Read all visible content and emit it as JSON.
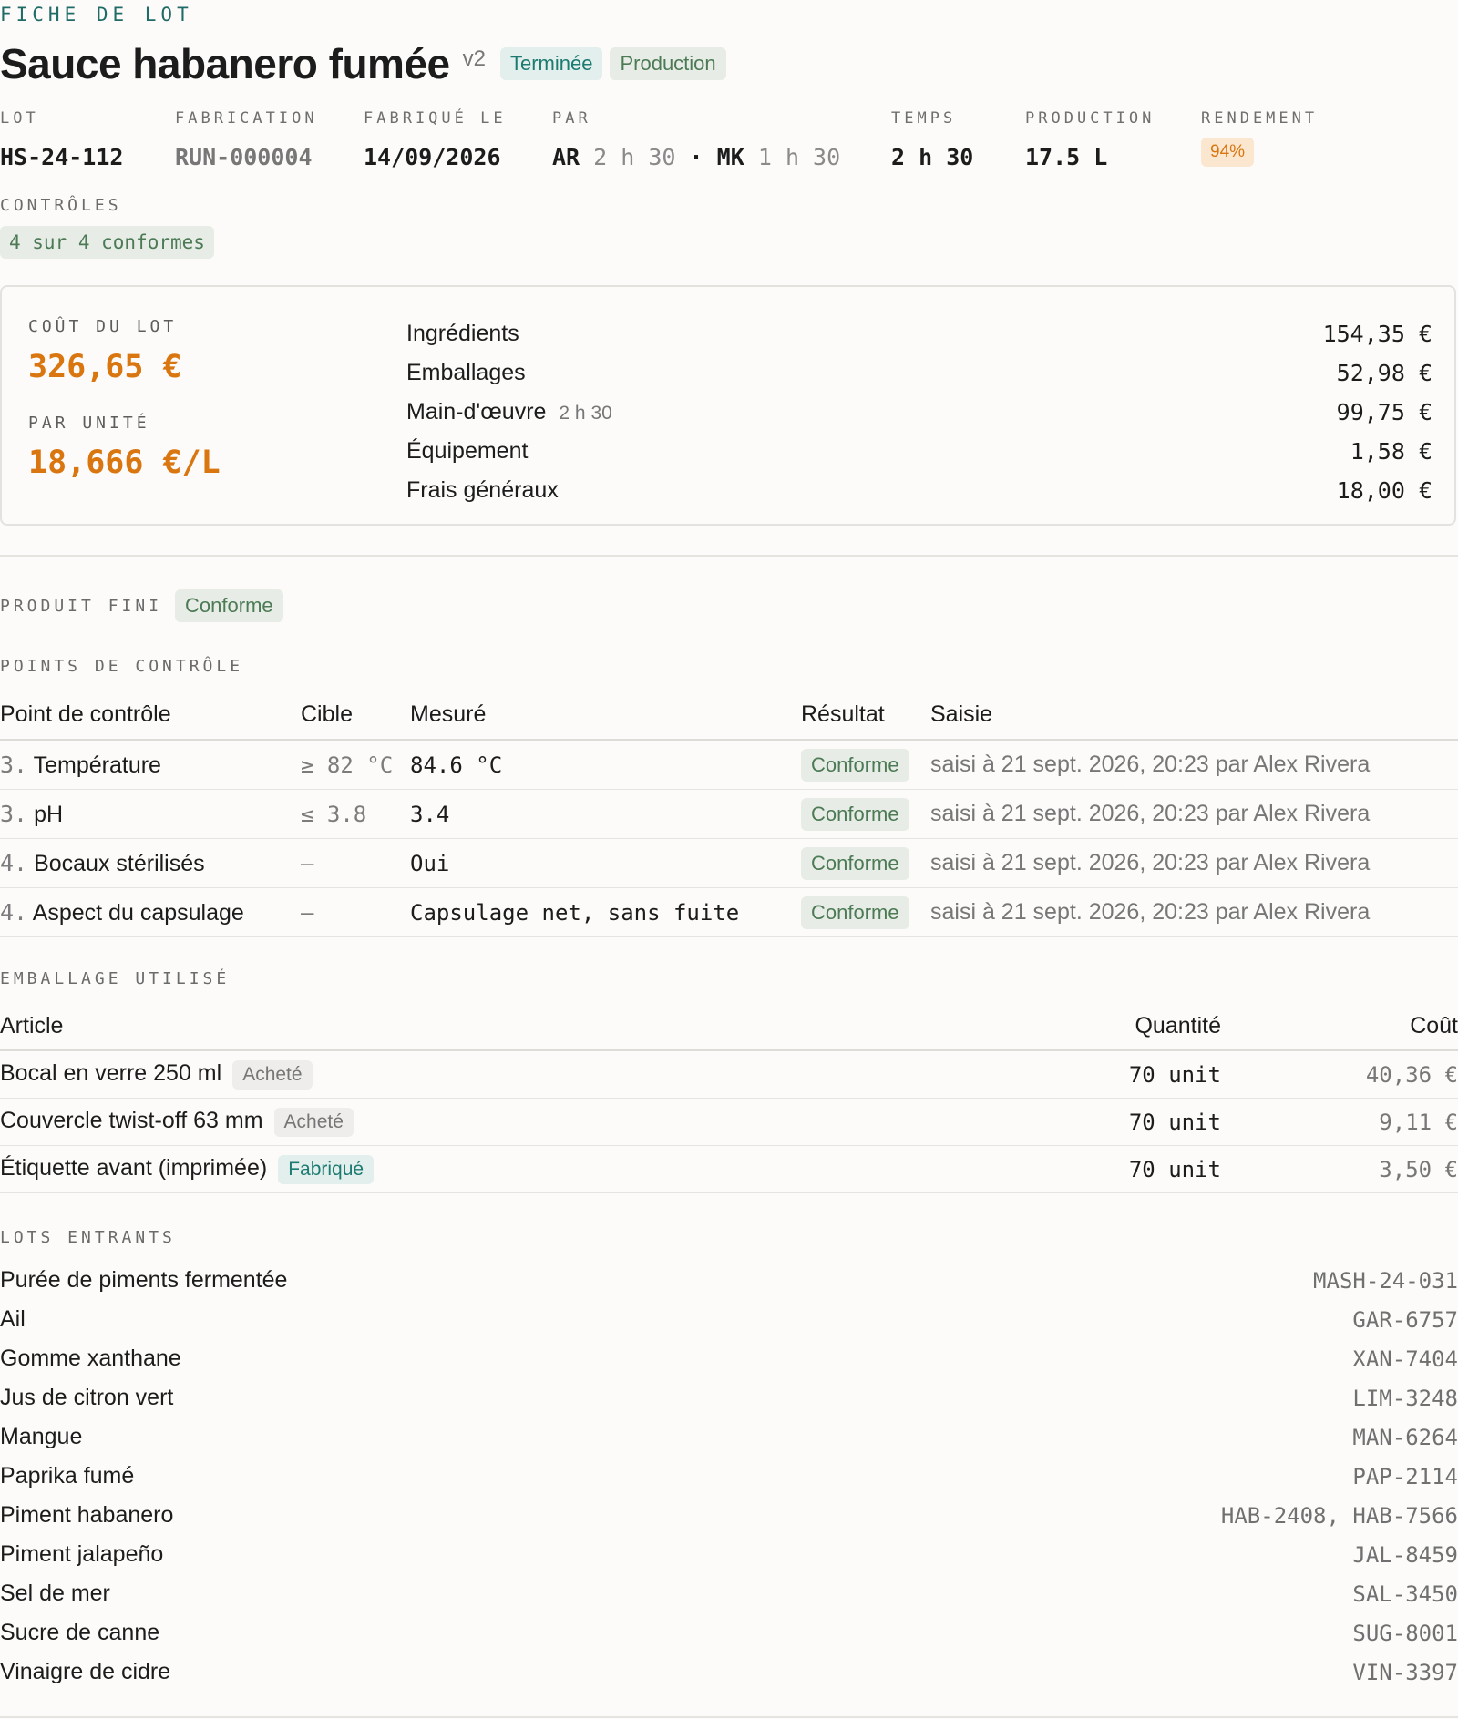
{
  "header": {
    "kicker": "FICHE DE LOT",
    "title": "Sauce habanero fumée",
    "version": "v2",
    "status_tag": "Terminée",
    "type_tag": "Production"
  },
  "meta": {
    "lot": {
      "label": "LOT",
      "value": "HS-24-112"
    },
    "fabrication": {
      "label": "FABRICATION",
      "value": "RUN-000004"
    },
    "fabrique_le": {
      "label": "FABRIQUÉ LE",
      "value": "14/09/2026"
    },
    "par": {
      "label": "PAR",
      "op1": "AR",
      "op1_time": "2 h 30",
      "sep": "·",
      "op2": "MK",
      "op2_time": "1 h 30"
    },
    "temps": {
      "label": "TEMPS",
      "value": "2 h 30"
    },
    "production": {
      "label": "PRODUCTION",
      "value": "17.5 L"
    },
    "rendement": {
      "label": "RENDEMENT",
      "value": "94%"
    }
  },
  "controles": {
    "label": "CONTRÔLES",
    "summary": "4 sur 4 conformes"
  },
  "cost": {
    "lot_label": "COÛT DU LOT",
    "lot_value": "326,65 €",
    "unit_label": "PAR UNITÉ",
    "unit_value": "18,666 €/L",
    "lines": [
      {
        "label": "Ingrédients",
        "sub": "",
        "amount": "154,35 €"
      },
      {
        "label": "Emballages",
        "sub": "",
        "amount": "52,98 €"
      },
      {
        "label": "Main-d'œuvre",
        "sub": "2 h 30",
        "amount": "99,75 €"
      },
      {
        "label": "Équipement",
        "sub": "",
        "amount": "1,58 €"
      },
      {
        "label": "Frais généraux",
        "sub": "",
        "amount": "18,00 €"
      }
    ]
  },
  "produit_fini": {
    "label": "PRODUIT FINI",
    "status": "Conforme"
  },
  "points": {
    "label": "POINTS DE CONTRÔLE",
    "headers": [
      "Point de contrôle",
      "Cible",
      "Mesuré",
      "Résultat",
      "Saisie"
    ],
    "rows": [
      {
        "num": "3.",
        "name": "Température",
        "target": "≥ 82 °C",
        "measured": "84.6 °C",
        "result": "Conforme",
        "entry": "saisi à 21 sept. 2026, 20:23 par Alex Rivera"
      },
      {
        "num": "3.",
        "name": "pH",
        "target": "≤ 3.8",
        "measured": "3.4",
        "result": "Conforme",
        "entry": "saisi à 21 sept. 2026, 20:23 par Alex Rivera"
      },
      {
        "num": "4.",
        "name": "Bocaux stérilisés",
        "target": "—",
        "measured": "Oui",
        "result": "Conforme",
        "entry": "saisi à 21 sept. 2026, 20:23 par Alex Rivera"
      },
      {
        "num": "4.",
        "name": "Aspect du capsulage",
        "target": "—",
        "measured": "Capsulage net, sans fuite",
        "result": "Conforme",
        "entry": "saisi à 21 sept. 2026, 20:23 par Alex Rivera"
      }
    ]
  },
  "emballage": {
    "label": "EMBALLAGE UTILISÉ",
    "headers": [
      "Article",
      "Quantité",
      "Coût"
    ],
    "rows": [
      {
        "name": "Bocal en verre 250 ml",
        "tag": "Acheté",
        "qty": "70 unit",
        "cost": "40,36 €"
      },
      {
        "name": "Couvercle twist-off 63 mm",
        "tag": "Acheté",
        "qty": "70 unit",
        "cost": "9,11 €"
      },
      {
        "name": "Étiquette avant (imprimée)",
        "tag": "Fabriqué",
        "qty": "70 unit",
        "cost": "3,50 €"
      }
    ]
  },
  "lots_entrants": {
    "label": "LOTS ENTRANTS",
    "rows": [
      {
        "name": "Purée de piments fermentée",
        "codes": "MASH-24-031"
      },
      {
        "name": "Ail",
        "codes": "GAR-6757"
      },
      {
        "name": "Gomme xanthane",
        "codes": "XAN-7404"
      },
      {
        "name": "Jus de citron vert",
        "codes": "LIM-3248"
      },
      {
        "name": "Mangue",
        "codes": "MAN-6264"
      },
      {
        "name": "Paprika fumé",
        "codes": "PAP-2114"
      },
      {
        "name": "Piment habanero",
        "codes": "HAB-2408, HAB-7566"
      },
      {
        "name": "Piment jalapeño",
        "codes": "JAL-8459"
      },
      {
        "name": "Sel de mer",
        "codes": "SAL-3450"
      },
      {
        "name": "Sucre de canne",
        "codes": "SUG-8001"
      },
      {
        "name": "Vinaigre de cidre",
        "codes": "VIN-3397"
      }
    ]
  },
  "colors": {
    "accent_orange": "#d9760f",
    "accent_teal": "#1c7a70",
    "ok_green": "#4c7a55"
  }
}
